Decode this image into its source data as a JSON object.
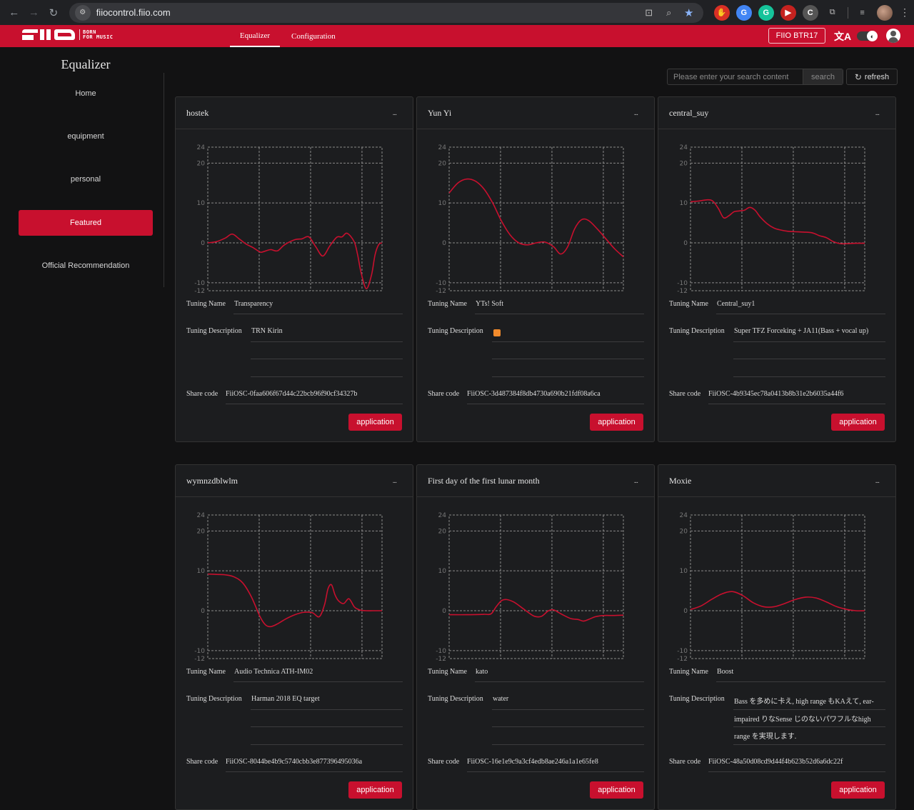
{
  "browser": {
    "url": "fiiocontrol.fiio.com",
    "extensions": [
      {
        "name": "adblock-extension-icon",
        "glyph": "✋",
        "color": "#d93025"
      },
      {
        "name": "google-translate-extension-icon",
        "glyph": "G",
        "color": "#4285f4"
      },
      {
        "name": "grammarly-extension-icon",
        "glyph": "G",
        "color": "#15c39a"
      },
      {
        "name": "screen-recorder-extension-icon",
        "glyph": "▶",
        "color": "#c5221f"
      },
      {
        "name": "chatgpt-extension-icon",
        "glyph": "C",
        "color": "#555"
      },
      {
        "name": "extensions-puzzle-icon",
        "glyph": "⧉",
        "color": "transparent"
      }
    ]
  },
  "header": {
    "logo_text": "FIIO",
    "logo_tag_line1": "BORN",
    "logo_tag_line2": "FOR MUSIC",
    "tabs": [
      {
        "label": "Equalizer",
        "active": true
      },
      {
        "label": "Configuration",
        "active": false
      }
    ],
    "device_label": "FIIO BTR17",
    "translate_glyph": "文A",
    "theme_glyph": "◐",
    "accent_color": "#c8102e"
  },
  "sidebar": {
    "title": "Equalizer",
    "items": [
      {
        "label": "Home",
        "active": false
      },
      {
        "label": "equipment",
        "active": false
      },
      {
        "label": "personal",
        "active": false
      },
      {
        "label": "Featured",
        "active": true
      },
      {
        "label": "Official Recommendation",
        "active": false
      }
    ]
  },
  "toolbar": {
    "search_placeholder": "Please enter your search content",
    "search_value": "",
    "search_label": "search",
    "refresh_label": "refresh",
    "refresh_glyph": "↻"
  },
  "labels": {
    "tuning_name": "Tuning Name",
    "tuning_description": "Tuning Description",
    "share_code": "Share code",
    "apply": "application",
    "more": "..."
  },
  "cards": [
    {
      "title": "hostek",
      "tuning_name": "Transparency",
      "description_lines": [
        "TRN Kirin",
        "",
        ""
      ],
      "share_code": "FiiOSC-0faa606f67d44c22bcb96f90cf34327b"
    },
    {
      "title": "Yun Yi",
      "tuning_name": "YTs! Soft",
      "description_lines": [
        "",
        "",
        ""
      ],
      "description_has_emoji": true,
      "share_code": "FiiOSC-3d487384f8db4730a690b21fdf08a6ca"
    },
    {
      "title": "central_suy",
      "tuning_name": "Central_suy1",
      "description_lines": [
        "Super TFZ Forceking + JA11(Bass + vocal up)",
        "",
        ""
      ],
      "share_code": "FiiOSC-4b9345ec78a0413b8b31e2b6035a44f6"
    },
    {
      "title": "wymnzdblwlm",
      "tuning_name": "Audio Technica ATH-IM02",
      "description_lines": [
        "Harman 2018 EQ target",
        "",
        ""
      ],
      "share_code": "FiiOSC-8044be4b9c5740cbb3e877396495036a"
    },
    {
      "title": "First day of the first lunar month",
      "tuning_name": "kato",
      "description_lines": [
        "water",
        "",
        ""
      ],
      "share_code": "FiiOSC-16e1e9c9a3cf4edb8ae246a1a1e65fe8"
    },
    {
      "title": "Moxie",
      "tuning_name": "Boost",
      "description_lines": [
        "Bass を多めに卡え, high range もKAえて, ear-",
        "impaired りなSense じのないパワフルなhigh",
        "range を実現します."
      ],
      "share_code": "FiiOSC-48a50d08cd9d44f4b623b52d6a6dc22f"
    }
  ],
  "chart_data": [
    {
      "type": "line",
      "title": "hostek",
      "ylim": [
        -12,
        24
      ],
      "yticks": [
        24,
        20,
        10,
        0,
        -10,
        -12
      ],
      "grid": true,
      "line_color": "#c8102e",
      "x": [
        0,
        0.05,
        0.1,
        0.14,
        0.18,
        0.22,
        0.26,
        0.3,
        0.32,
        0.36,
        0.4,
        0.44,
        0.5,
        0.54,
        0.58,
        0.62,
        0.66,
        0.7,
        0.74,
        0.77,
        0.8,
        0.84,
        0.86,
        0.88,
        0.91,
        0.94,
        0.96,
        0.98,
        1.0
      ],
      "y": [
        0,
        0.3,
        1.2,
        2.2,
        1.0,
        -0.3,
        -1.2,
        -2.3,
        -2.2,
        -1.7,
        -2.0,
        -0.5,
        0.8,
        1.0,
        1.5,
        -1.0,
        -3.3,
        -0.8,
        1.4,
        1.5,
        2.4,
        0.3,
        -3.0,
        -7.5,
        -11.5,
        -8.0,
        -3.0,
        -0.5,
        0
      ]
    },
    {
      "type": "line",
      "title": "Yun Yi",
      "ylim": [
        -12,
        24
      ],
      "yticks": [
        24,
        20,
        10,
        0,
        -10,
        -12
      ],
      "grid": true,
      "line_color": "#c8102e",
      "x": [
        0,
        0.05,
        0.1,
        0.15,
        0.2,
        0.25,
        0.3,
        0.35,
        0.4,
        0.45,
        0.5,
        0.55,
        0.6,
        0.64,
        0.68,
        0.72,
        0.76,
        0.8,
        0.85,
        0.9,
        0.95,
        1.0
      ],
      "y": [
        12.5,
        15.0,
        16.0,
        15.5,
        13.5,
        10.0,
        5.5,
        2.0,
        0.0,
        -0.5,
        0.0,
        0.2,
        -1.0,
        -2.8,
        -1.0,
        3.5,
        5.8,
        5.6,
        3.5,
        1.0,
        -1.5,
        -3.5
      ]
    },
    {
      "type": "line",
      "title": "central_suy",
      "ylim": [
        -12,
        24
      ],
      "yticks": [
        24,
        20,
        10,
        0,
        -10,
        -12
      ],
      "grid": true,
      "line_color": "#c8102e",
      "x": [
        0,
        0.05,
        0.1,
        0.13,
        0.16,
        0.19,
        0.22,
        0.25,
        0.28,
        0.31,
        0.34,
        0.37,
        0.4,
        0.44,
        0.48,
        0.52,
        0.56,
        0.6,
        0.65,
        0.7,
        0.74,
        0.78,
        0.82,
        0.86,
        0.9,
        0.95,
        1.0
      ],
      "y": [
        10.3,
        10.5,
        10.8,
        10.4,
        8.6,
        6.3,
        6.8,
        7.8,
        8.0,
        8.2,
        8.9,
        8.2,
        6.5,
        4.8,
        3.7,
        3.2,
        2.9,
        2.8,
        2.7,
        2.5,
        1.8,
        1.3,
        0.3,
        -0.2,
        -0.2,
        -0.1,
        -0.1
      ]
    },
    {
      "type": "line",
      "title": "wymnzdblwlm",
      "ylim": [
        -12,
        24
      ],
      "yticks": [
        24,
        20,
        10,
        0,
        -10,
        -12
      ],
      "grid": true,
      "line_color": "#c8102e",
      "x": [
        0,
        0.05,
        0.1,
        0.15,
        0.2,
        0.25,
        0.3,
        0.33,
        0.36,
        0.4,
        0.45,
        0.5,
        0.55,
        0.6,
        0.64,
        0.67,
        0.69,
        0.71,
        0.73,
        0.75,
        0.78,
        0.81,
        0.84,
        0.86,
        0.88,
        0.91,
        0.95,
        1.0
      ],
      "y": [
        9.2,
        9.1,
        9.0,
        8.5,
        7.0,
        3.5,
        -1.5,
        -3.5,
        -4.0,
        -3.3,
        -2.0,
        -1.0,
        -0.4,
        -0.5,
        -1.5,
        1.5,
        5.5,
        6.5,
        4.0,
        2.5,
        1.8,
        3.0,
        1.0,
        0.4,
        0.1,
        0.0,
        0.0,
        0.0
      ]
    },
    {
      "type": "line",
      "title": "First day of the first lunar month",
      "ylim": [
        -12,
        24
      ],
      "yticks": [
        24,
        20,
        10,
        0,
        -10,
        -12
      ],
      "grid": true,
      "line_color": "#c8102e",
      "x": [
        0,
        0.1,
        0.2,
        0.24,
        0.27,
        0.3,
        0.33,
        0.37,
        0.41,
        0.45,
        0.49,
        0.53,
        0.57,
        0.6,
        0.63,
        0.66,
        0.7,
        0.74,
        0.77,
        0.8,
        0.84,
        0.89,
        0.94,
        1.0
      ],
      "y": [
        -1.0,
        -1.0,
        -0.9,
        -0.8,
        1.0,
        2.5,
        2.8,
        2.2,
        1.0,
        -0.3,
        -1.4,
        -1.4,
        0.0,
        0.2,
        -0.5,
        -1.2,
        -2.0,
        -2.2,
        -2.6,
        -2.2,
        -1.5,
        -1.2,
        -1.2,
        -1.1
      ]
    },
    {
      "type": "line",
      "title": "Moxie",
      "ylim": [
        -12,
        24
      ],
      "yticks": [
        24,
        20,
        10,
        0,
        -10,
        -12
      ],
      "grid": true,
      "line_color": "#c8102e",
      "x": [
        0,
        0.06,
        0.12,
        0.18,
        0.24,
        0.3,
        0.36,
        0.42,
        0.48,
        0.54,
        0.6,
        0.66,
        0.72,
        0.78,
        0.84,
        0.9,
        0.95,
        1.0
      ],
      "y": [
        0.3,
        1.2,
        2.8,
        4.2,
        4.8,
        3.8,
        2.0,
        1.0,
        1.0,
        1.8,
        2.8,
        3.4,
        3.2,
        2.2,
        1.0,
        0.3,
        0.0,
        0.0
      ]
    }
  ]
}
